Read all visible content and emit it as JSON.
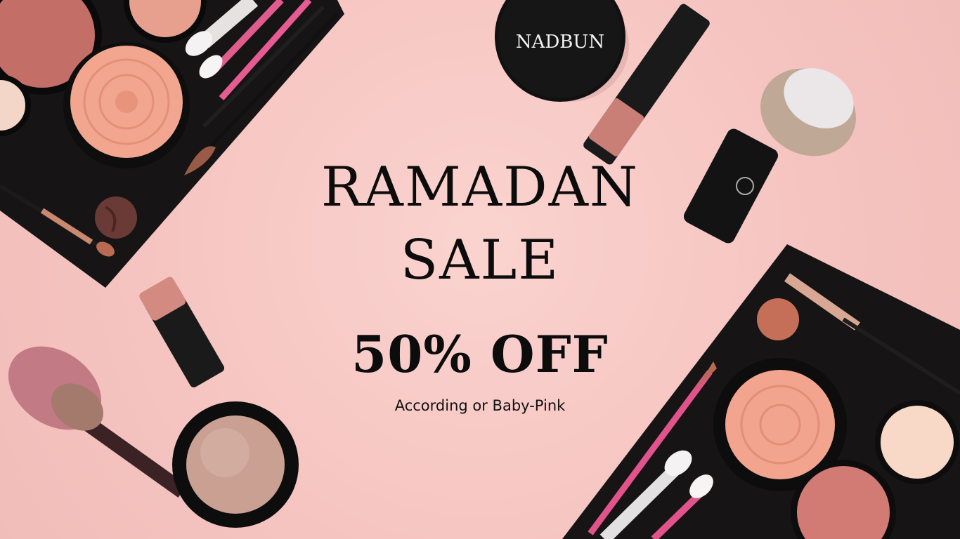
{
  "banner": {
    "line1": "RAMADAN",
    "line2": "SALE",
    "line3": "50% OFF",
    "subtitle": "According or Baby-Pink"
  },
  "compact_logo_text": "NADBUN",
  "colors": {
    "background": "#f7c9c5",
    "palette_black": "#161414",
    "blush": "#ef9f8c",
    "text": "#0c0c0c"
  },
  "icons": [
    "makeup-palette-icon",
    "brush-icon",
    "compact-icon",
    "lipstick-icon",
    "eyeshadow-icon"
  ]
}
